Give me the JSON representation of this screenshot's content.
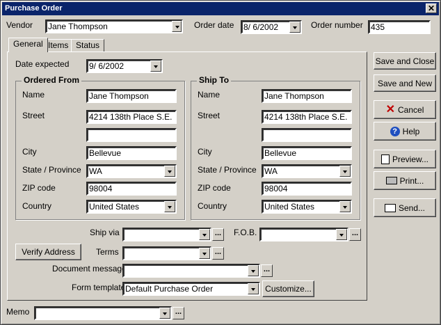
{
  "window": {
    "title": "Purchase Order",
    "close": "✕"
  },
  "header": {
    "vendor_label": "Vendor",
    "vendor_value": "Jane Thompson",
    "order_date_label": "Order date",
    "order_date_value": "8/  6/2002",
    "order_number_label": "Order number",
    "order_number_value": "435"
  },
  "tabs": [
    "General",
    "Items",
    "Status"
  ],
  "general": {
    "date_expected_label": "Date expected",
    "date_expected_value": "9/  6/2002"
  },
  "ordered_from": {
    "title": "Ordered From",
    "name_label": "Name",
    "name": "Jane Thompson",
    "street_label": "Street",
    "street1": "4214 138th Place S.E.",
    "street2": "",
    "city_label": "City",
    "city": "Bellevue",
    "state_label": "State / Province",
    "state": "WA",
    "zip_label": "ZIP code",
    "zip": "98004",
    "country_label": "Country",
    "country": "United States"
  },
  "ship_to": {
    "title": "Ship To",
    "name_label": "Name",
    "name": "Jane Thompson",
    "street_label": "Street",
    "street1": "4214 138th Place S.E.",
    "street2": "",
    "city_label": "City",
    "city": "Bellevue",
    "state_label": "State / Province",
    "state": "WA",
    "zip_label": "ZIP code",
    "zip": "98004",
    "country_label": "Country",
    "country": "United States"
  },
  "shipping": {
    "ship_via_label": "Ship via",
    "ship_via": "",
    "fob_label": "F.O.B.",
    "fob": "",
    "terms_label": "Terms",
    "terms": "",
    "doc_message_label": "Document message",
    "doc_message": "",
    "form_template_label": "Form template",
    "form_template": "Default Purchase Order",
    "verify_address": "Verify Address",
    "customize": "Customize...",
    "ellipsis": "..."
  },
  "memo": {
    "label": "Memo",
    "value": ""
  },
  "actions": {
    "save_close": "Save and Close",
    "save_new": "Save and New",
    "cancel": "Cancel",
    "help": "Help",
    "preview": "Preview...",
    "print": "Print...",
    "send": "Send..."
  }
}
